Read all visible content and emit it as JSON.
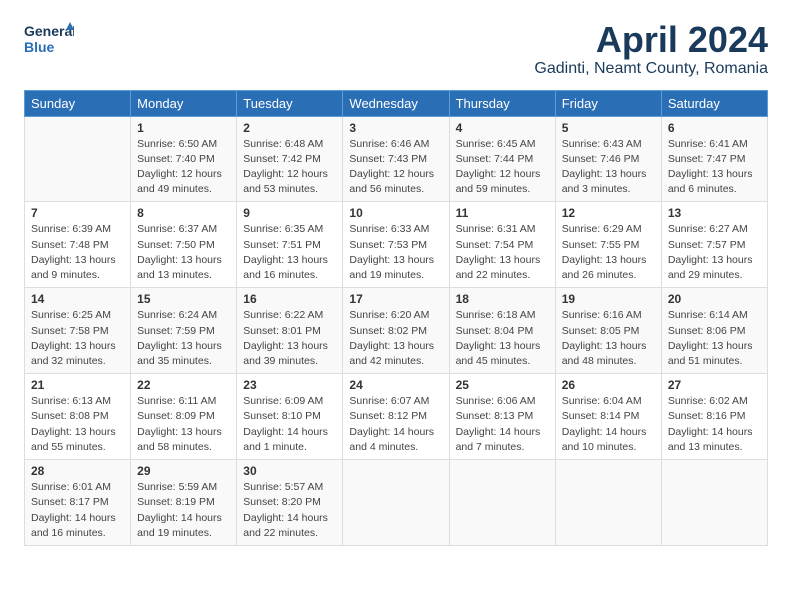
{
  "header": {
    "logo_line1": "General",
    "logo_line2": "Blue",
    "title": "April 2024",
    "subtitle": "Gadinti, Neamt County, Romania"
  },
  "days_of_week": [
    "Sunday",
    "Monday",
    "Tuesday",
    "Wednesday",
    "Thursday",
    "Friday",
    "Saturday"
  ],
  "weeks": [
    [
      {
        "day": "",
        "info": ""
      },
      {
        "day": "1",
        "info": "Sunrise: 6:50 AM\nSunset: 7:40 PM\nDaylight: 12 hours\nand 49 minutes."
      },
      {
        "day": "2",
        "info": "Sunrise: 6:48 AM\nSunset: 7:42 PM\nDaylight: 12 hours\nand 53 minutes."
      },
      {
        "day": "3",
        "info": "Sunrise: 6:46 AM\nSunset: 7:43 PM\nDaylight: 12 hours\nand 56 minutes."
      },
      {
        "day": "4",
        "info": "Sunrise: 6:45 AM\nSunset: 7:44 PM\nDaylight: 12 hours\nand 59 minutes."
      },
      {
        "day": "5",
        "info": "Sunrise: 6:43 AM\nSunset: 7:46 PM\nDaylight: 13 hours\nand 3 minutes."
      },
      {
        "day": "6",
        "info": "Sunrise: 6:41 AM\nSunset: 7:47 PM\nDaylight: 13 hours\nand 6 minutes."
      }
    ],
    [
      {
        "day": "7",
        "info": "Sunrise: 6:39 AM\nSunset: 7:48 PM\nDaylight: 13 hours\nand 9 minutes."
      },
      {
        "day": "8",
        "info": "Sunrise: 6:37 AM\nSunset: 7:50 PM\nDaylight: 13 hours\nand 13 minutes."
      },
      {
        "day": "9",
        "info": "Sunrise: 6:35 AM\nSunset: 7:51 PM\nDaylight: 13 hours\nand 16 minutes."
      },
      {
        "day": "10",
        "info": "Sunrise: 6:33 AM\nSunset: 7:53 PM\nDaylight: 13 hours\nand 19 minutes."
      },
      {
        "day": "11",
        "info": "Sunrise: 6:31 AM\nSunset: 7:54 PM\nDaylight: 13 hours\nand 22 minutes."
      },
      {
        "day": "12",
        "info": "Sunrise: 6:29 AM\nSunset: 7:55 PM\nDaylight: 13 hours\nand 26 minutes."
      },
      {
        "day": "13",
        "info": "Sunrise: 6:27 AM\nSunset: 7:57 PM\nDaylight: 13 hours\nand 29 minutes."
      }
    ],
    [
      {
        "day": "14",
        "info": "Sunrise: 6:25 AM\nSunset: 7:58 PM\nDaylight: 13 hours\nand 32 minutes."
      },
      {
        "day": "15",
        "info": "Sunrise: 6:24 AM\nSunset: 7:59 PM\nDaylight: 13 hours\nand 35 minutes."
      },
      {
        "day": "16",
        "info": "Sunrise: 6:22 AM\nSunset: 8:01 PM\nDaylight: 13 hours\nand 39 minutes."
      },
      {
        "day": "17",
        "info": "Sunrise: 6:20 AM\nSunset: 8:02 PM\nDaylight: 13 hours\nand 42 minutes."
      },
      {
        "day": "18",
        "info": "Sunrise: 6:18 AM\nSunset: 8:04 PM\nDaylight: 13 hours\nand 45 minutes."
      },
      {
        "day": "19",
        "info": "Sunrise: 6:16 AM\nSunset: 8:05 PM\nDaylight: 13 hours\nand 48 minutes."
      },
      {
        "day": "20",
        "info": "Sunrise: 6:14 AM\nSunset: 8:06 PM\nDaylight: 13 hours\nand 51 minutes."
      }
    ],
    [
      {
        "day": "21",
        "info": "Sunrise: 6:13 AM\nSunset: 8:08 PM\nDaylight: 13 hours\nand 55 minutes."
      },
      {
        "day": "22",
        "info": "Sunrise: 6:11 AM\nSunset: 8:09 PM\nDaylight: 13 hours\nand 58 minutes."
      },
      {
        "day": "23",
        "info": "Sunrise: 6:09 AM\nSunset: 8:10 PM\nDaylight: 14 hours\nand 1 minute."
      },
      {
        "day": "24",
        "info": "Sunrise: 6:07 AM\nSunset: 8:12 PM\nDaylight: 14 hours\nand 4 minutes."
      },
      {
        "day": "25",
        "info": "Sunrise: 6:06 AM\nSunset: 8:13 PM\nDaylight: 14 hours\nand 7 minutes."
      },
      {
        "day": "26",
        "info": "Sunrise: 6:04 AM\nSunset: 8:14 PM\nDaylight: 14 hours\nand 10 minutes."
      },
      {
        "day": "27",
        "info": "Sunrise: 6:02 AM\nSunset: 8:16 PM\nDaylight: 14 hours\nand 13 minutes."
      }
    ],
    [
      {
        "day": "28",
        "info": "Sunrise: 6:01 AM\nSunset: 8:17 PM\nDaylight: 14 hours\nand 16 minutes."
      },
      {
        "day": "29",
        "info": "Sunrise: 5:59 AM\nSunset: 8:19 PM\nDaylight: 14 hours\nand 19 minutes."
      },
      {
        "day": "30",
        "info": "Sunrise: 5:57 AM\nSunset: 8:20 PM\nDaylight: 14 hours\nand 22 minutes."
      },
      {
        "day": "",
        "info": ""
      },
      {
        "day": "",
        "info": ""
      },
      {
        "day": "",
        "info": ""
      },
      {
        "day": "",
        "info": ""
      }
    ]
  ]
}
